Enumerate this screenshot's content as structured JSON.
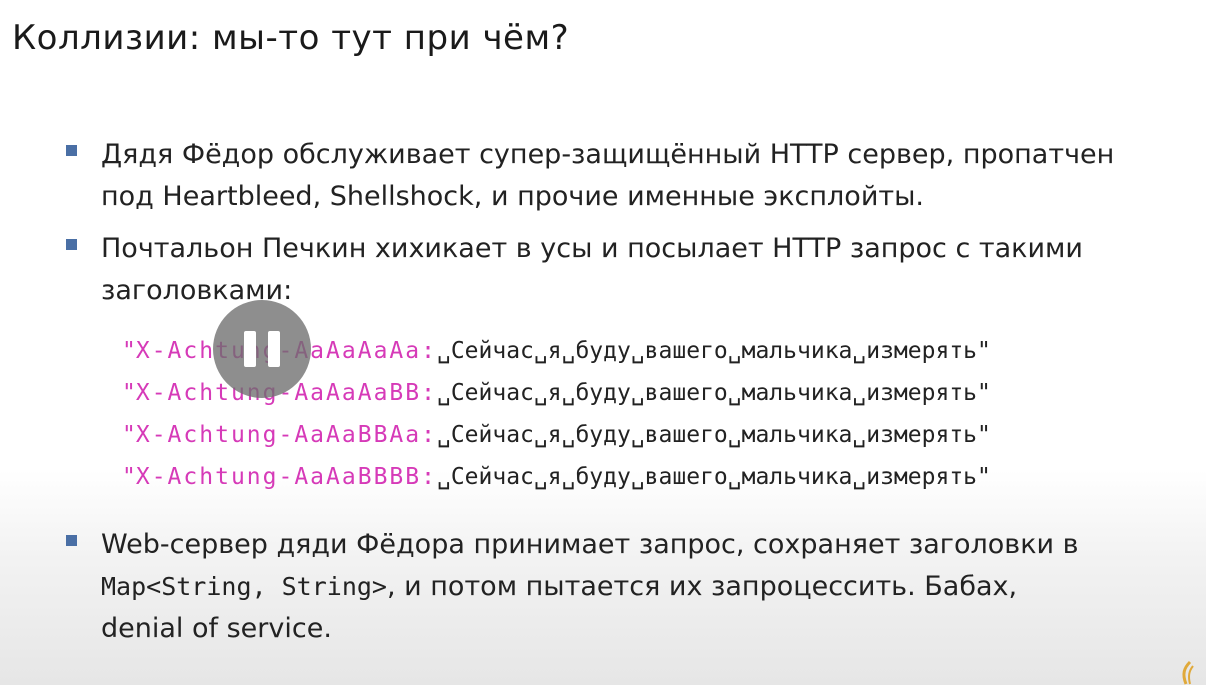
{
  "slide": {
    "title": "Коллизии: мы-то тут при чём?"
  },
  "bullets": [
    {
      "line1": "Дядя Фёдор обслуживает супер-защищённый HTTP сервер, пропатчен",
      "line2": "под Heartbleed, Shellshock, и прочие именные эксплойты."
    },
    {
      "line1": "Почтальон Печкин хихикает в усы и посылает HTTP запрос с такими",
      "line2": "заголовками:"
    }
  ],
  "headers": [
    {
      "open_quote": "\"",
      "key": "X-Achtung-AaAaAaAa:",
      "value": "␣Сейчас␣я␣буду␣вашего␣мальчика␣измерять\""
    },
    {
      "open_quote": "\"",
      "key": "X-Achtung-AaAaAaBB:",
      "value": "␣Сейчас␣я␣буду␣вашего␣мальчика␣измерять\""
    },
    {
      "open_quote": "\"",
      "key": "X-Achtung-AaAaBBAa:",
      "value": "␣Сейчас␣я␣буду␣вашего␣мальчика␣измерять\""
    },
    {
      "open_quote": "\"",
      "key": "X-Achtung-AaAaBBBB:",
      "value": "␣Сейчас␣я␣буду␣вашего␣мальчика␣измерять\""
    }
  ],
  "final_bullet": {
    "line1": "Web-сервер дяди Фёдора принимает запрос, сохраняет заголовки в",
    "line2_code": "Map<String, String>",
    "line2_rest": ", и потом пытается их запроцессить. Бабах,",
    "line3": "denial of service."
  },
  "icons": {
    "bullet": "square-bullet-icon",
    "pause": "pause-icon",
    "logo": "corner-logo-icon"
  },
  "colors": {
    "bullet": "#4a6fa5",
    "code_key": "#d63ab8"
  }
}
